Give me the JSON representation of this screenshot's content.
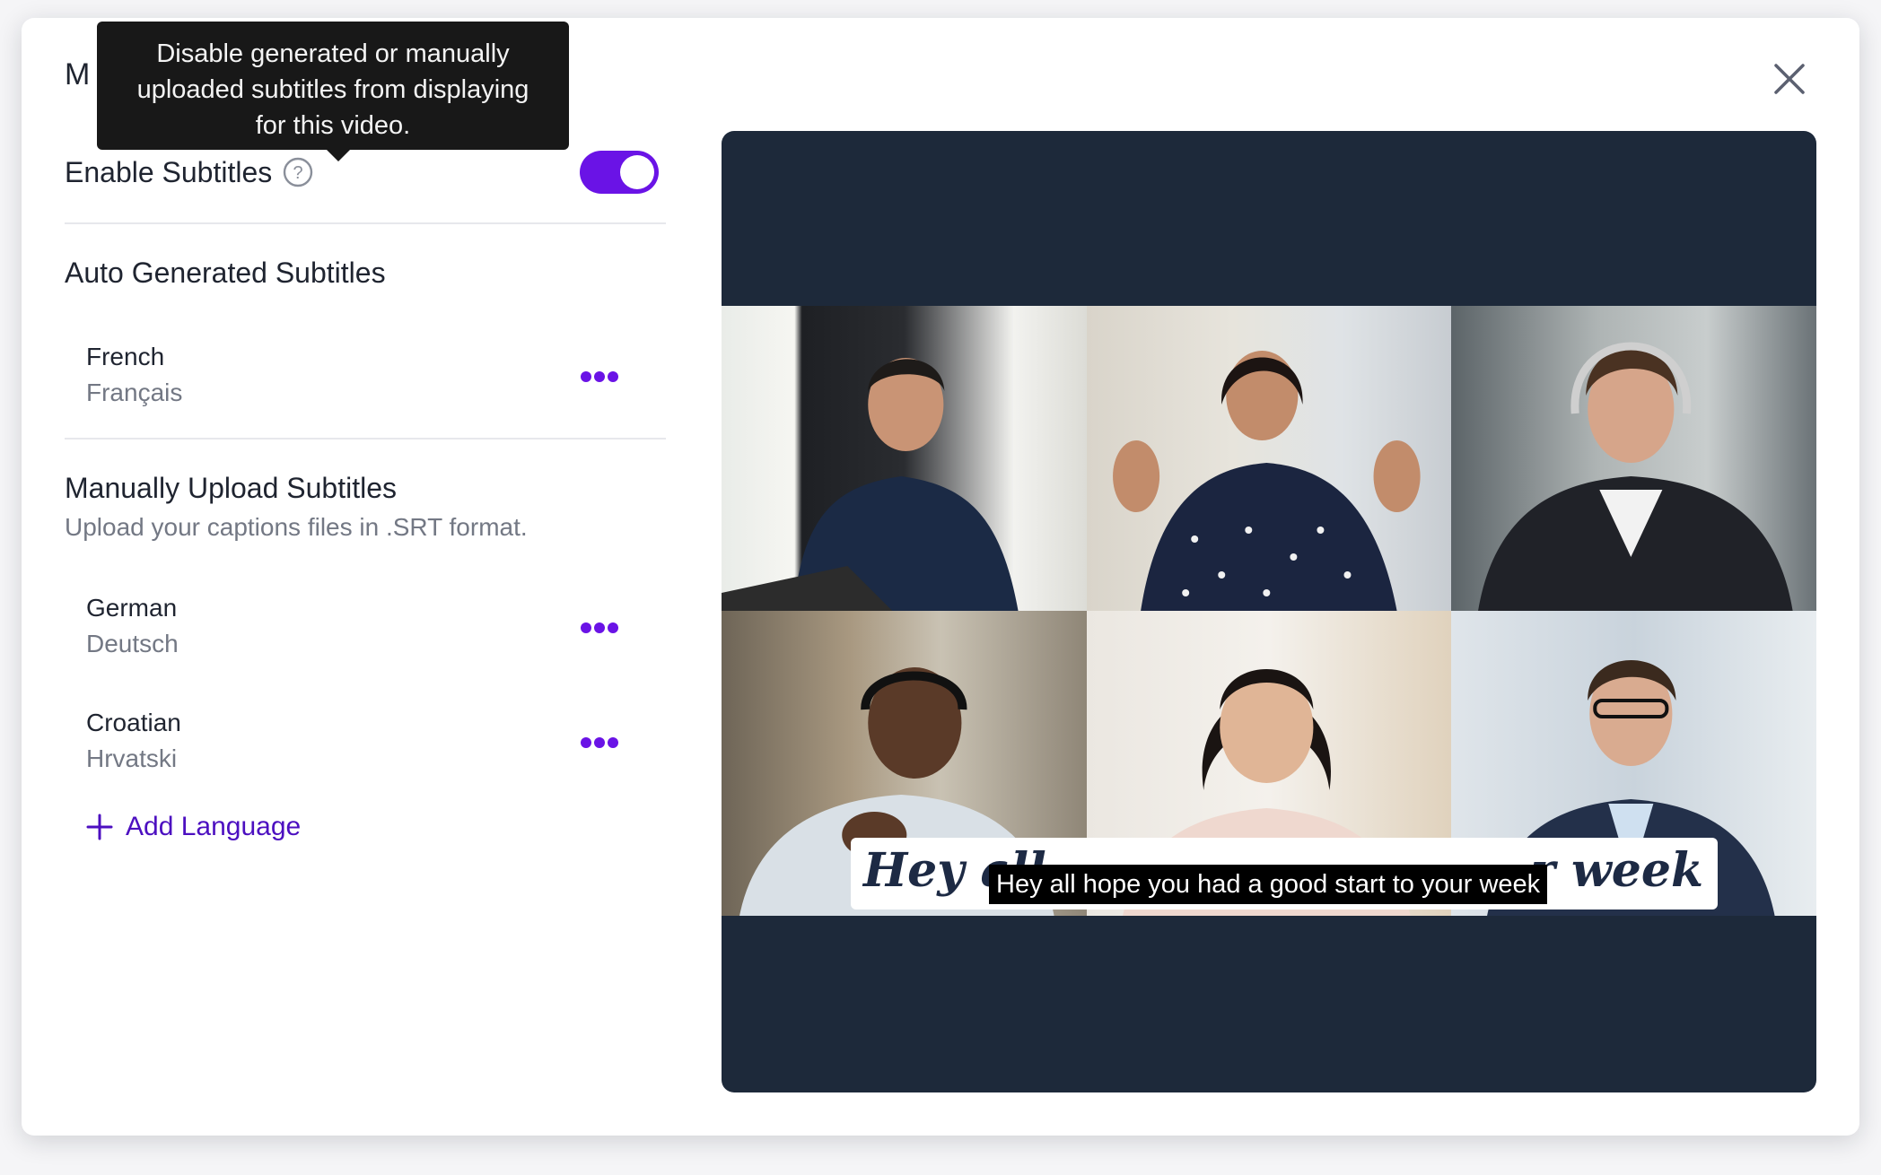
{
  "modal": {
    "title": "M",
    "tooltip_text": "Disable generated or manually uploaded subtitles from displaying for this video.",
    "close_icon": "close-icon"
  },
  "enable": {
    "label": "Enable Subtitles",
    "help_icon": "question-circle-icon",
    "toggle_on": true
  },
  "auto": {
    "title": "Auto Generated Subtitles",
    "languages": [
      {
        "name": "French",
        "native": "Français"
      }
    ]
  },
  "manual": {
    "title": "Manually Upload Subtitles",
    "subtitle": "Upload your captions files in .SRT format.",
    "languages": [
      {
        "name": "German",
        "native": "Deutsch"
      },
      {
        "name": "Croatian",
        "native": "Hrvatski"
      }
    ],
    "add_label": "Add Language"
  },
  "preview": {
    "caption_left": "Hey all",
    "caption_right": "r week",
    "subtitle": "Hey all hope you had a good start to your week"
  },
  "colors": {
    "accent": "#6a13e6",
    "link": "#4c0fc0",
    "preview_bg": "#1d293a"
  }
}
